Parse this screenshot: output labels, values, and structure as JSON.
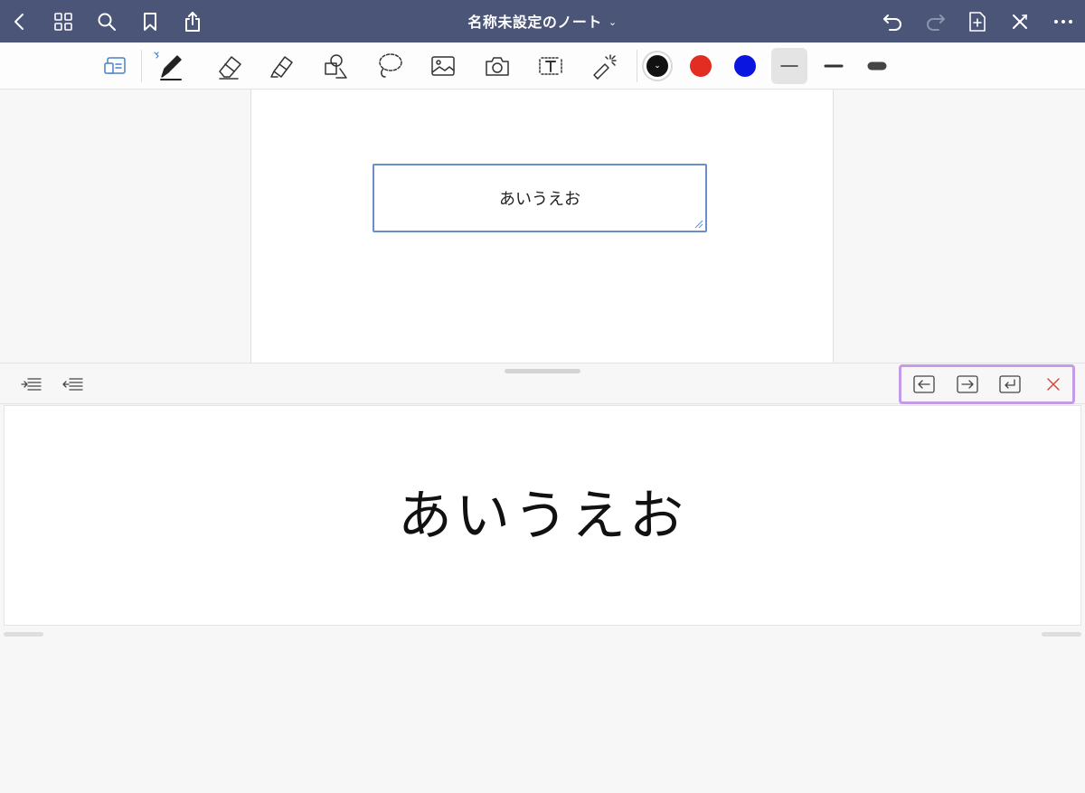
{
  "titlebar": {
    "title": "名称未設定のノート",
    "title_chevron": "⌄",
    "icons": [
      "back-icon",
      "grid-icon",
      "search-icon",
      "bookmark-icon",
      "share-icon",
      "undo-icon",
      "redo-icon",
      "add-page-icon",
      "close-tools-icon",
      "more-icon"
    ]
  },
  "toolbar": {
    "tools": [
      "page-layout-icon",
      "pen-icon",
      "eraser-icon",
      "highlighter-icon",
      "shapes-icon",
      "lasso-icon",
      "image-icon",
      "camera-icon",
      "text-icon",
      "laser-pointer-icon"
    ],
    "colors": [
      "#111111",
      "#e32d23",
      "#0b15e0"
    ],
    "selected_color": "#111111",
    "selected_tool": "text-icon",
    "stroke_widths": [
      "thin",
      "medium",
      "thick"
    ],
    "selected_stroke": "thin"
  },
  "page": {
    "textbox_text": "あいうえお"
  },
  "panel": {
    "editor_text": "あいうえお",
    "left_buttons": [
      "indent-icon",
      "outdent-icon"
    ],
    "right_buttons": [
      "move-left-icon",
      "move-right-icon",
      "return-icon",
      "close-icon"
    ],
    "close_color": "#d9453a"
  }
}
